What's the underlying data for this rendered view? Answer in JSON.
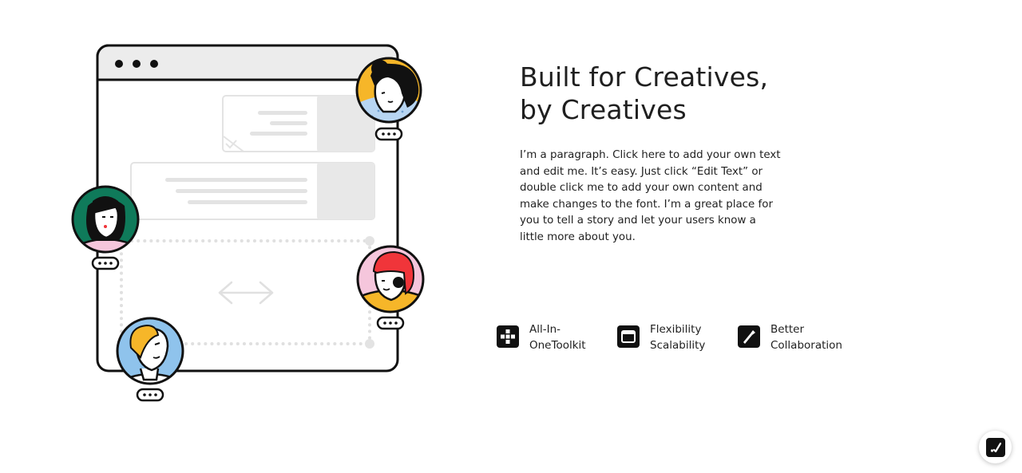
{
  "hero": {
    "heading_line1": "Built for Creatives,",
    "heading_line2": "by Creatives",
    "paragraph": "I’m a paragraph. Click here to add your own text and edit me. It’s easy. Just click “Edit Text” or double click me to add your own content and make changes to the font. I’m a great place for you to tell a story and let your users know a little more about you."
  },
  "features": [
    {
      "icon": "grid-blocks-icon",
      "line1": "All-In-",
      "line2": "OneToolkit"
    },
    {
      "icon": "browser-window-icon",
      "line1": "Flexibility",
      "line2": "Scalability"
    },
    {
      "icon": "pen-nib-icon",
      "line1": "Better",
      "line2": "Collaboration"
    }
  ],
  "fab": {
    "icon": "edit-check-icon"
  },
  "colors": {
    "outline": "#111111",
    "panel_gray": "#ececec",
    "light_gray": "#e3e3e3",
    "yellow": "#f6b629",
    "pink": "#f5c6dc",
    "green": "#0f7a5a",
    "blue": "#8fc3ec",
    "red": "#f0353a"
  }
}
